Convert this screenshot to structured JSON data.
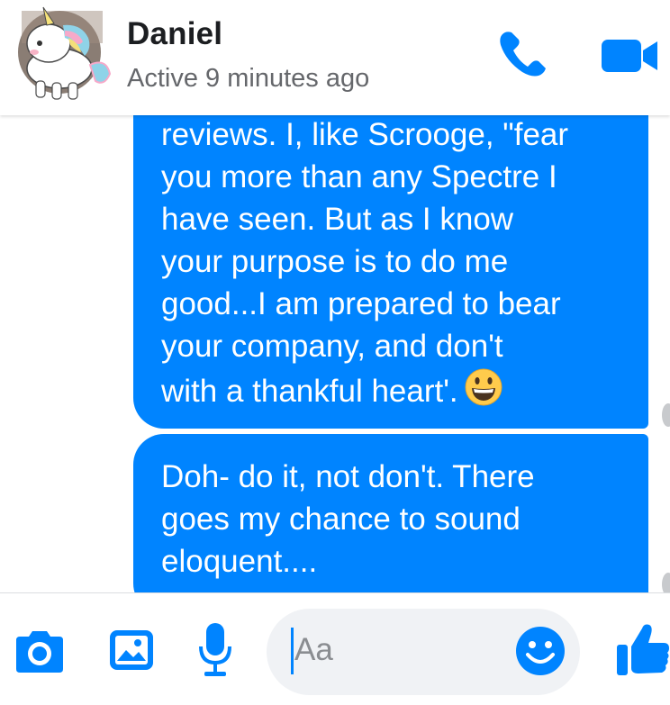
{
  "header": {
    "contact_name": "Daniel",
    "status": "Active 9 minutes ago",
    "avatar_icon": "unicorn-avatar",
    "call_icon": "phone-icon",
    "video_icon": "video-camera-icon"
  },
  "messages": [
    {
      "sender": "me",
      "lines": [
        "reviews. I, like Scrooge, \"fear",
        "you more than any Spectre I",
        "have seen. But as I know",
        "your purpose is to do me",
        "good...I am prepared to bear",
        "your company, and don't",
        "with a thankful heart'."
      ],
      "emoji": "grinning-face-emoji"
    },
    {
      "sender": "me",
      "lines": [
        "Doh- do it, not don't. There",
        "goes my chance to sound",
        "eloquent...."
      ]
    }
  ],
  "composer": {
    "placeholder": "Aa",
    "icons": [
      "camera-icon",
      "gallery-icon",
      "microphone-icon",
      "emoji-icon",
      "thumbs-up-icon"
    ]
  },
  "colors": {
    "accent": "#0084ff",
    "bubble_text": "#ffffff",
    "name_text": "#1c1e21",
    "status_text": "#65676b",
    "emoji_yellow": "#ffcb4c"
  }
}
